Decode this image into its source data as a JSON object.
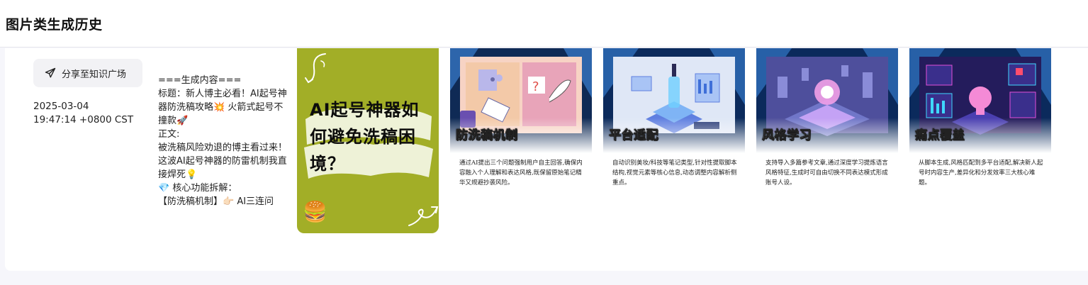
{
  "header": {
    "title": "图片类生成历史"
  },
  "record": {
    "share_label": "分享至知识广场",
    "date": "2025-03-04",
    "time": "19:47:14 +0800 CST",
    "content_lines": [
      "===生成内容===",
      "标题：新人博主必看！AI起号神器防洗稿攻略💥 火箭式起号不撞款🚀",
      "",
      "正文:",
      "被洗稿风险劝退的博主看过来！",
      "这波AI起号神器的防雷机制我直接焊死💡",
      "",
      "💎 核心功能拆解：",
      "【防洗稿机制】👉🏻 AI三连问"
    ]
  },
  "cover": {
    "headline": "AI起号神器如何避免洗稿困境？",
    "background_color": "#a2ae27",
    "burger_icon": "🍔"
  },
  "tiles": [
    {
      "title": "防洗稿机制",
      "description": "通过AI提出三个问题强制用户自主回答,确保内容融入个人理解和表达风格,既保留原始笔记精华又规避抄袭风险。",
      "theme": "puzzle"
    },
    {
      "title": "平台适配",
      "description": "自动识别美妆/科技等笔记类型,针对性提取脚本结构,视觉元素等核心信息,动态调整内容解析侧重点。",
      "theme": "platform"
    },
    {
      "title": "风格学习",
      "description": "支持导入多篇参考文章,通过深度学习提炼语言风格特征,生成时可自由切换不同表达模式形成账号人设。",
      "theme": "hologram"
    },
    {
      "title": "痛点覆盖",
      "description": "从脚本生成,风格匹配到多平台适配,解决新人起号时内容生产,差异化和分发效率三大核心难题。",
      "theme": "dashboard"
    }
  ]
}
